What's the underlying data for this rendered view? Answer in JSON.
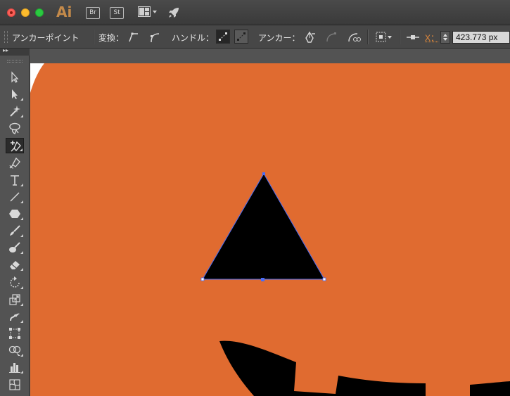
{
  "app": {
    "logo": "Ai"
  },
  "titlebar": {
    "bridge_label": "Br",
    "stock_label": "St"
  },
  "controlbar": {
    "tool_name": "アンカーポイント",
    "convert_label": "変換：",
    "handle_label": "ハンドル：",
    "anchor_label": "アンカー：",
    "x_label": "X：",
    "x_value": "423.773 px"
  },
  "tools": [
    {
      "name": "selection-tool",
      "icon": "arrow-icon",
      "has_flyout": false
    },
    {
      "name": "direct-selection-tool",
      "icon": "hollow-arrow-icon",
      "has_flyout": true
    },
    {
      "name": "magic-wand-tool",
      "icon": "magic-wand-icon",
      "has_flyout": true
    },
    {
      "name": "lasso-tool",
      "icon": "lasso-icon",
      "has_flyout": false
    },
    {
      "name": "add-anchor-tool",
      "icon": "pen-plus-icon",
      "has_flyout": true,
      "active": true
    },
    {
      "name": "curvature-tool",
      "icon": "pen-icon",
      "has_flyout": false
    },
    {
      "name": "type-tool",
      "icon": "type-icon",
      "has_flyout": true
    },
    {
      "name": "line-tool",
      "icon": "line-icon",
      "has_flyout": true
    },
    {
      "name": "polygon-tool",
      "icon": "hexagon-icon",
      "has_flyout": true
    },
    {
      "name": "paintbrush-tool",
      "icon": "brush-icon",
      "has_flyout": true
    },
    {
      "name": "blob-brush-tool",
      "icon": "blob-brush-icon",
      "has_flyout": true
    },
    {
      "name": "eraser-tool",
      "icon": "eraser-icon",
      "has_flyout": true
    },
    {
      "name": "rotate-tool",
      "icon": "rotate-icon",
      "has_flyout": true
    },
    {
      "name": "scale-tool",
      "icon": "scale-icon",
      "has_flyout": true
    },
    {
      "name": "warp-tool",
      "icon": "warp-icon",
      "has_flyout": true
    },
    {
      "name": "free-transform-tool",
      "icon": "free-transform-icon",
      "has_flyout": false
    },
    {
      "name": "shape-builder-tool",
      "icon": "shape-builder-icon",
      "has_flyout": true
    },
    {
      "name": "graph-tool",
      "icon": "bar-graph-icon",
      "has_flyout": true
    },
    {
      "name": "mesh-tool",
      "icon": "mesh-icon",
      "has_flyout": false
    }
  ],
  "colors": {
    "pumpkin": "#e06b30",
    "shape_fill": "#000000",
    "selection": "#4a6cf5",
    "x_label": "#e48a3b"
  }
}
